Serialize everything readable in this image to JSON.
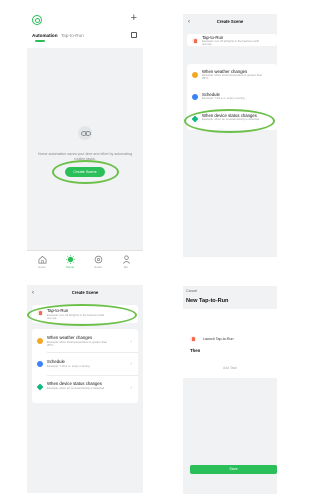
{
  "automation_screen": {
    "tabs": [
      {
        "label": "Automation",
        "active": true
      },
      {
        "label": "Tap-to-Run",
        "active": false
      }
    ],
    "empty_text": "Home automation saves your time and effort by automating routine tasks.",
    "create_button": "Create Scene",
    "nav": [
      {
        "label": "Home",
        "icon": "home-icon"
      },
      {
        "label": "Scene",
        "icon": "scene-icon",
        "active": true
      },
      {
        "label": "Smart",
        "icon": "smart-icon"
      },
      {
        "label": "Me",
        "icon": "user-icon"
      }
    ]
  },
  "create_scene_screen": {
    "title": "Create Scene",
    "items": [
      {
        "title": "Tap-to-Run",
        "desc": "Example: turn off all lights in the bedroom with one tap.",
        "icon": "tap-to-run-icon"
      },
      {
        "title": "When weather changes",
        "desc": "Example: when local temperature is greater than 28°C.",
        "icon": "weather-icon"
      },
      {
        "title": "Schedule",
        "desc": "Example: 7:00 a.m. every morning",
        "icon": "schedule-icon"
      },
      {
        "title": "When device status changes",
        "desc": "Example: when an unusual activity is detected.",
        "icon": "device-status-icon"
      }
    ]
  },
  "new_tap_to_run_screen": {
    "cancel": "Cancel",
    "title": "New Tap-to-Run",
    "if_label": "If",
    "launch_label": "Launch Tap-to-Run",
    "then_label": "Then",
    "add_task": "Add Task",
    "save": "Save"
  },
  "colors": {
    "accent": "#2bbf5a",
    "highlight_ring": "#6cc04a",
    "background": "#f1f2f4"
  }
}
